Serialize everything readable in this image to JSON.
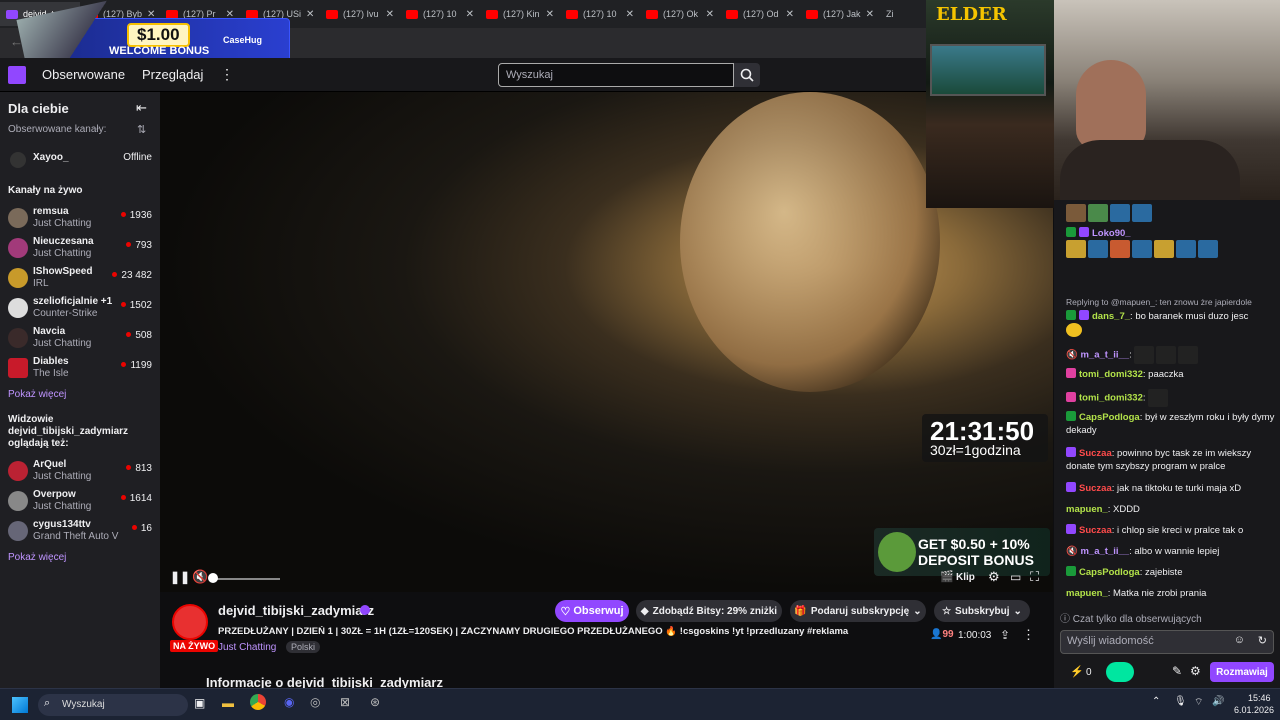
{
  "browser": {
    "tabs": [
      {
        "label": "dejvid_t"
      },
      {
        "label": "(127) Byb"
      },
      {
        "label": "(127) Pr"
      },
      {
        "label": "(127) USi"
      },
      {
        "label": "(127) Ivu"
      },
      {
        "label": "(127) 10"
      },
      {
        "label": "(127) Kin"
      },
      {
        "label": "(127) 10"
      },
      {
        "label": "(127) Ok"
      },
      {
        "label": "(127) Od"
      },
      {
        "label": "(127) Jak"
      },
      {
        "label": "Zi"
      }
    ]
  },
  "ad": {
    "amount": "$1.00",
    "text": "WELCOME BONUS",
    "brand": "CaseHug"
  },
  "twitch_nav": {
    "followed": "Obserwowane",
    "browse": "Przeglądaj",
    "more": "⋮",
    "search_placeholder": "Wyszukaj"
  },
  "sidebar": {
    "title": "Dla ciebie",
    "followed_header": "Obserwowane kanały:",
    "followed": [
      {
        "name": "Xayoo_",
        "status": "Offline"
      }
    ],
    "live_header": "Kanały na żywo",
    "live": [
      {
        "name": "remsua",
        "category": "Just Chatting",
        "viewers": "1936"
      },
      {
        "name": "Nieuczesana",
        "category": "Just Chatting",
        "viewers": "793"
      },
      {
        "name": "IShowSpeed",
        "category": "IRL",
        "viewers": "23 482"
      },
      {
        "name": "szelioficjalnie +1",
        "category": "Counter-Strike",
        "viewers": "1502"
      },
      {
        "name": "Navcia",
        "category": "Just Chatting",
        "viewers": "508"
      },
      {
        "name": "Diables",
        "category": "The Isle",
        "viewers": "1199"
      }
    ],
    "show_more": "Pokaż więcej",
    "viewers_also_header": "Widzowie dejvid_tibijski_zadymiarz oglądają też:",
    "viewers_also": [
      {
        "name": "ArQuel",
        "category": "Just Chatting",
        "viewers": "813"
      },
      {
        "name": "Overpow",
        "category": "Just Chatting",
        "viewers": "1614"
      },
      {
        "name": "cygus134ttv",
        "category": "Grand Theft Auto V",
        "viewers": "16"
      }
    ],
    "show_more2": "Pokaż więcej"
  },
  "video": {
    "timer": "21:31:50",
    "rate": "30zł=1godzina",
    "bonus_line1": "GET $0.50 + 10%",
    "bonus_line2": "DEPOSIT BONUS",
    "clip": "Klip"
  },
  "webcam": {
    "brand": "ELDER"
  },
  "stream": {
    "channel": "dejvid_tibijski_zadymiarz",
    "title": "PRZEDŁUŻANY | DZIEŃ 1 | 30ZŁ = 1H (1ZŁ=120SEK) | ZACZYNAMY DRUGIEGO PRZEDŁUŻANEGO 🔥 !csgoskins !yt !przedluzany #reklama",
    "live_badge": "NA ŻYWO",
    "category": "Just Chatting",
    "tag": "Polski",
    "follow": "Obserwuj",
    "bits": "Zdobądź Bitsy: 29% zniżki",
    "gift": "Podaruj subskrypcję",
    "subscribe": "Subskrybuj",
    "viewers": "99",
    "uptime": "1:00:03",
    "about": "Informacje o dejvid_tibijski_zadymiarz"
  },
  "chat": {
    "messages": [
      {
        "user": "Loko90_",
        "text": "",
        "color": "#bf94ff"
      },
      {
        "reply": "Replying to @mapuen_: ten znowu żre japierdole"
      },
      {
        "user": "dans_7_",
        "text": "bo baranek musi duzo jesc",
        "color": "#b3e34a"
      },
      {
        "user": "m_a_t_ii__",
        "text": "",
        "color": "#bf94ff"
      },
      {
        "user": "tomi_domi332",
        "text": "paaczka",
        "color": "#b3e34a"
      },
      {
        "user": "tomi_domi332",
        "text": "",
        "color": "#b3e34a"
      },
      {
        "user": "CapsPodloga",
        "text": "był w zeszłym roku i były dymy dekady",
        "color": "#b3e34a"
      },
      {
        "user": "Suczaa",
        "text": "powinno byc task ze im wiekszy donate tym szybszy program w pralce",
        "color": "#ff4b4b"
      },
      {
        "user": "Suczaa",
        "text": "jak na tiktoku te turki maja xD",
        "color": "#ff4b4b"
      },
      {
        "user": "mapuen_",
        "text": "XDDD",
        "color": "#b3e34a"
      },
      {
        "user": "Suczaa",
        "text": "i chlop sie kreci w pralce tak o",
        "color": "#ff4b4b"
      },
      {
        "user": "m_a_t_ii__",
        "text": "albo w wannie lepiej",
        "color": "#bf94ff"
      },
      {
        "user": "CapsPodloga",
        "text": "zajebiste",
        "color": "#b3e34a"
      },
      {
        "user": "mapuen_",
        "text": "Matka nie zrobi prania",
        "color": "#b3e34a"
      }
    ],
    "followers_only": "Czat tylko dla obserwujących",
    "input_placeholder": "Wyślij wiadomość",
    "points": "0",
    "chat_button": "Rozmawiaj"
  },
  "taskbar": {
    "search": "Wyszukaj",
    "time": "15:46",
    "date": "6.01.2026"
  }
}
